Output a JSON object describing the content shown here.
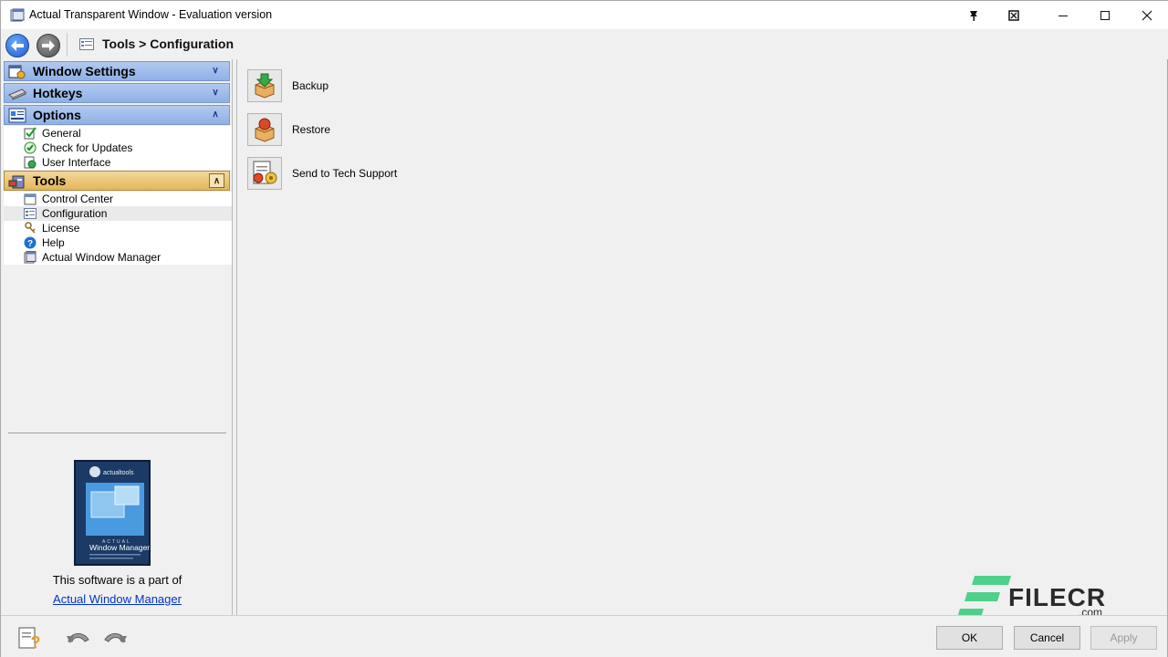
{
  "window": {
    "title": "Actual Transparent Window - Evaluation version",
    "controls": [
      "pin",
      "rollup",
      "minimize",
      "maximize",
      "close"
    ]
  },
  "nav": {
    "breadcrumb": "Tools > Configuration"
  },
  "sidebar": {
    "sections": [
      {
        "label": "Window Settings",
        "icon": "window-settings-icon",
        "state": "collapsed"
      },
      {
        "label": "Hotkeys",
        "icon": "keyboard-icon",
        "state": "collapsed"
      },
      {
        "label": "Options",
        "icon": "options-icon",
        "state": "expanded",
        "items": [
          {
            "label": "General",
            "icon": "general-icon"
          },
          {
            "label": "Check for Updates",
            "icon": "updates-icon"
          },
          {
            "label": "User Interface",
            "icon": "user-interface-icon"
          }
        ]
      },
      {
        "label": "Tools",
        "icon": "tools-icon",
        "state": "expanded",
        "items": [
          {
            "label": "Control Center",
            "icon": "control-center-icon"
          },
          {
            "label": "Configuration",
            "icon": "configuration-icon",
            "selected": true
          },
          {
            "label": "License",
            "icon": "license-icon"
          },
          {
            "label": "Help",
            "icon": "help-icon"
          },
          {
            "label": "Actual Window Manager",
            "icon": "window-manager-icon"
          }
        ]
      }
    ],
    "promo": {
      "box_brand": "actualtools",
      "box_subtitle": "ACTUAL",
      "box_title": "Window Manager",
      "text": "This software is a part of",
      "link": "Actual Window Manager"
    }
  },
  "main": {
    "actions": [
      {
        "label": "Backup",
        "icon": "backup-icon"
      },
      {
        "label": "Restore",
        "icon": "restore-icon"
      },
      {
        "label": "Send to Tech Support",
        "icon": "tech-support-icon"
      }
    ]
  },
  "watermark": {
    "text": "FILECR",
    "suffix": ".com"
  },
  "footer": {
    "ok": "OK",
    "cancel": "Cancel",
    "apply": "Apply"
  },
  "colors": {
    "section_blue": "#9fbcec",
    "section_tools": "#ebc475",
    "link": "#0033cc"
  }
}
